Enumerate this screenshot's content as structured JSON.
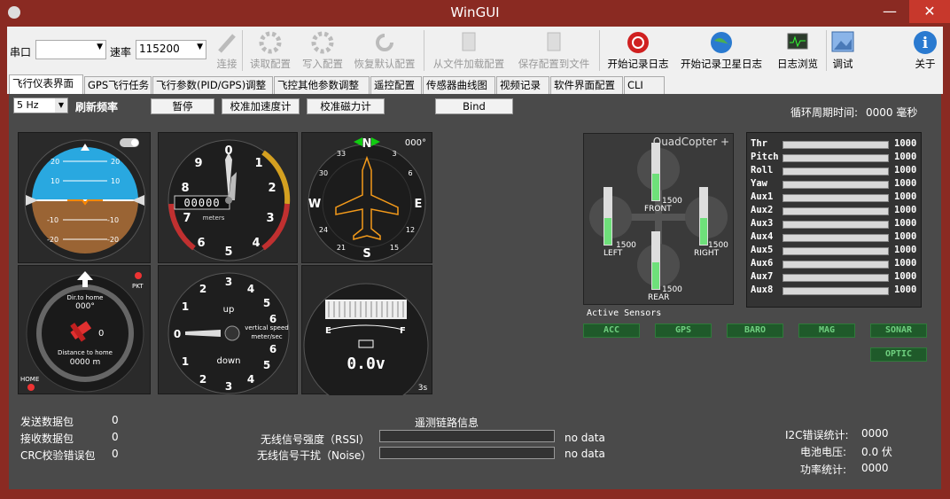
{
  "window": {
    "title": "WinGUI",
    "min": "—",
    "max": "□",
    "close": "✕"
  },
  "toolbar": {
    "port_label": "串口",
    "port_value": "",
    "rate_label": "速率",
    "rate_value": "115200",
    "connect": "连接",
    "read_config": "读取配置",
    "write_config": "写入配置",
    "restore_default": "恢复默认配置",
    "load_file": "从文件加载配置",
    "save_file": "保存配置到文件",
    "start_log": "开始记录日志",
    "start_sat_log": "开始记录卫星日志",
    "log_browse": "日志浏览",
    "debug": "调试",
    "about": "关于"
  },
  "tabs": [
    "飞行仪表界面",
    "GPS飞行任务",
    "飞行参数(PID/GPS)调整",
    "飞控其他参数调整",
    "遥控配置",
    "传感器曲线图",
    "视频记录",
    "软件界面配置",
    "CLI"
  ],
  "controls": {
    "rate_select": "5 Hz",
    "rate_label": "刷新频率",
    "pause": "暂停",
    "calib_acc": "校准加速度计",
    "calib_mag": "校准磁力计",
    "bind": "Bind",
    "cycle_label": "循环周期时间:",
    "cycle_value": "0000 毫秒"
  },
  "attitude": {
    "pitch_marks": [
      "20",
      "10",
      "-10",
      "-20"
    ]
  },
  "altimeter": {
    "digits": "00000",
    "unit": "meters",
    "numbers": [
      "0",
      "1",
      "2",
      "3",
      "4",
      "5",
      "6",
      "7",
      "8",
      "9"
    ]
  },
  "compass": {
    "n": "N",
    "e": "E",
    "s": "S",
    "w": "W",
    "heading": "000°",
    "ticks": [
      "33",
      "30",
      "3",
      "6",
      "12",
      "15",
      "21",
      "24"
    ]
  },
  "home": {
    "dir_label": "Dir.to home",
    "dir_value": "000°",
    "dist_label": "Distance to home",
    "dist_value": "0000 m",
    "pkt": "PKT",
    "home": "HOME",
    "sats": "0"
  },
  "vario": {
    "up": "up",
    "down": "down",
    "label": "vertical speed",
    "unit": "meter/sec",
    "numbers": [
      "0",
      "1",
      "2",
      "3",
      "4",
      "5",
      "6"
    ]
  },
  "battery": {
    "empty": "E",
    "full": "F",
    "voltage": "0.0v",
    "time": "3s"
  },
  "quad": {
    "type": "QuadCopter +",
    "front": "FRONT",
    "rear": "REAR",
    "left": "LEFT",
    "right": "RIGHT",
    "front_val": "1500",
    "rear_val": "1500",
    "left_val": "1500",
    "right_val": "1500",
    "level": 0.5
  },
  "rc": [
    {
      "name": "Thr",
      "value": "1000"
    },
    {
      "name": "Pitch",
      "value": "1000"
    },
    {
      "name": "Roll",
      "value": "1000"
    },
    {
      "name": "Yaw",
      "value": "1000"
    },
    {
      "name": "Aux1",
      "value": "1000"
    },
    {
      "name": "Aux2",
      "value": "1000"
    },
    {
      "name": "Aux3",
      "value": "1000"
    },
    {
      "name": "Aux4",
      "value": "1000"
    },
    {
      "name": "Aux5",
      "value": "1000"
    },
    {
      "name": "Aux6",
      "value": "1000"
    },
    {
      "name": "Aux7",
      "value": "1000"
    },
    {
      "name": "Aux8",
      "value": "1000"
    }
  ],
  "sensors": {
    "title": "Active Sensors",
    "list": [
      "ACC",
      "GPS",
      "BARO",
      "MAG",
      "SONAR",
      "OPTIC"
    ]
  },
  "packets": {
    "sent_label": "发送数据包",
    "sent": "0",
    "recv_label": "接收数据包",
    "recv": "0",
    "crc_label": "CRC校验错误包",
    "crc": "0"
  },
  "telemetry": {
    "title": "遥测链路信息",
    "rssi_label": "无线信号强度（RSSI）",
    "rssi_value": "no data",
    "noise_label": "无线信号干扰（Noise）",
    "noise_value": "no data"
  },
  "stats": {
    "i2c_label": "I2C错误统计:",
    "i2c": "0000",
    "volt_label": "电池电压:",
    "volt": "0.0 伏",
    "power_label": "功率统计:",
    "power": "0000"
  },
  "colors": {
    "titlebar": "#8a2a22",
    "panel": "#4a4a4a",
    "sky": "#29a8e0",
    "ground": "#9a6434",
    "motor_bar": "#6ee07a",
    "sensor_green": "#1f5a2a"
  }
}
